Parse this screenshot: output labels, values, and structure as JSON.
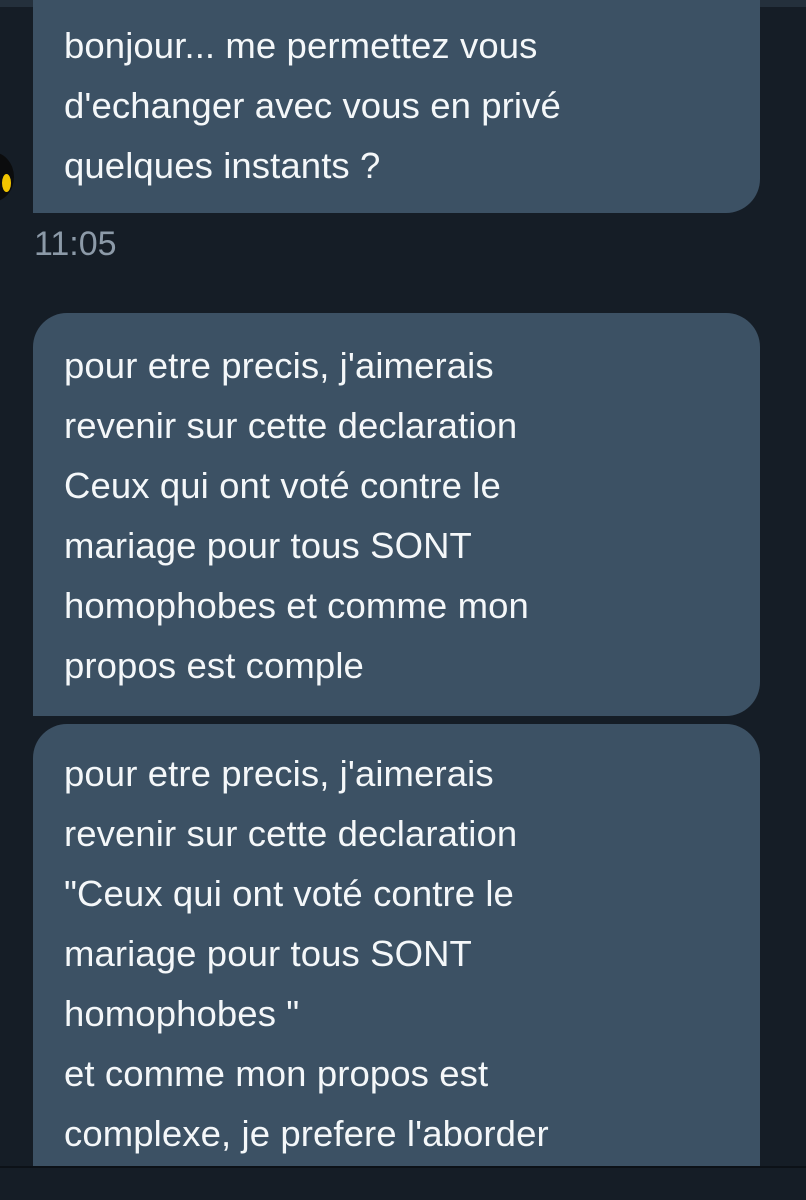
{
  "messages": [
    {
      "lines": [
        "bonjour... me permettez vous",
        "d'echanger avec vous en privé",
        "quelques instants ?"
      ],
      "time": "11:05"
    },
    {
      "lines": [
        "pour etre precis, j'aimerais",
        "revenir sur cette declaration",
        "Ceux qui ont voté contre le",
        "mariage pour tous SONT",
        "homophobes et comme mon",
        "propos est comple"
      ]
    },
    {
      "lines": [
        "pour etre precis, j'aimerais",
        "revenir sur cette declaration",
        "\"Ceux qui ont voté contre le",
        "mariage pour tous SONT",
        "homophobes \"",
        "et comme mon propos est",
        "complexe, je prefere l'aborder"
      ]
    }
  ],
  "colors": {
    "background": "#151d26",
    "bubble": "#3c5164",
    "text": "#f4f7f9",
    "timestamp": "#8c9aa8"
  }
}
